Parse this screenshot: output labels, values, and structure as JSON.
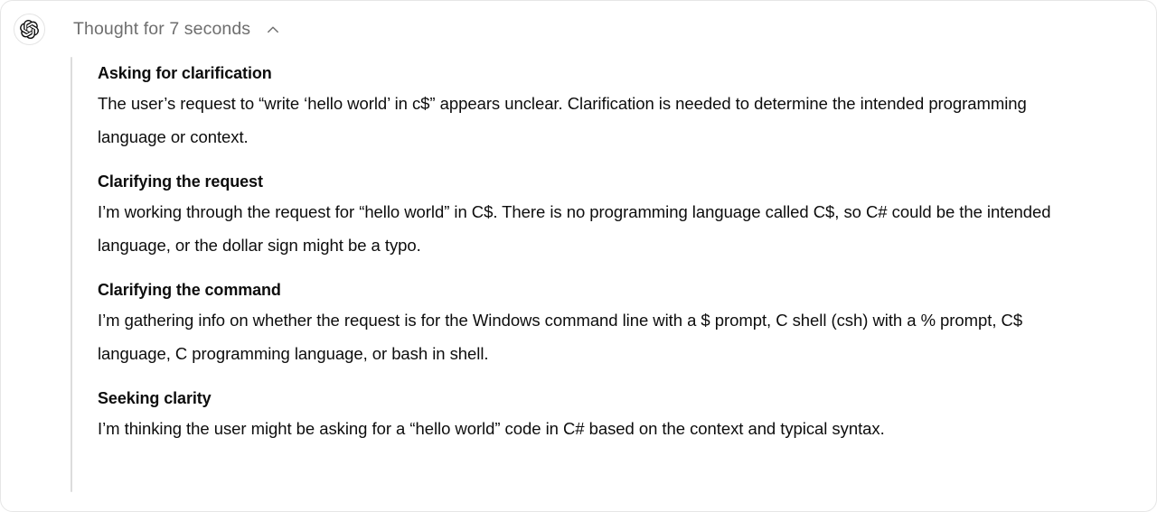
{
  "header": {
    "avatar_icon": "openai-logo-icon",
    "summary_label": "Thought for 7 seconds",
    "toggle_icon": "chevron-up-icon",
    "toggle_state": "expanded"
  },
  "colors": {
    "card_background": "#ffffff",
    "card_border": "#e6e6e6",
    "left_rule": "#dcdcdc",
    "heading_text": "#0d0d0d",
    "body_text": "#0d0d0d",
    "summary_text": "#6e6e6e",
    "chevron": "#6e6e6e"
  },
  "reasoning": {
    "sections": [
      {
        "title": "Asking for clarification",
        "text": "The user’s request to “write ‘hello world’ in c$” appears unclear. Clarification is needed to determine the intended programming language or context."
      },
      {
        "title": "Clarifying the request",
        "text": "I’m working through the request for “hello world” in C$. There is no programming language called C$, so C# could be the intended language, or the dollar sign might be a typo."
      },
      {
        "title": "Clarifying the command",
        "text": "I’m gathering info on whether the request is for the Windows command line with a $ prompt, C shell (csh) with a % prompt, C$ language, C programming language, or bash in shell."
      },
      {
        "title": "Seeking clarity",
        "text": "I’m thinking the user might be asking for a “hello world” code in C# based on the context and typical syntax."
      }
    ]
  }
}
